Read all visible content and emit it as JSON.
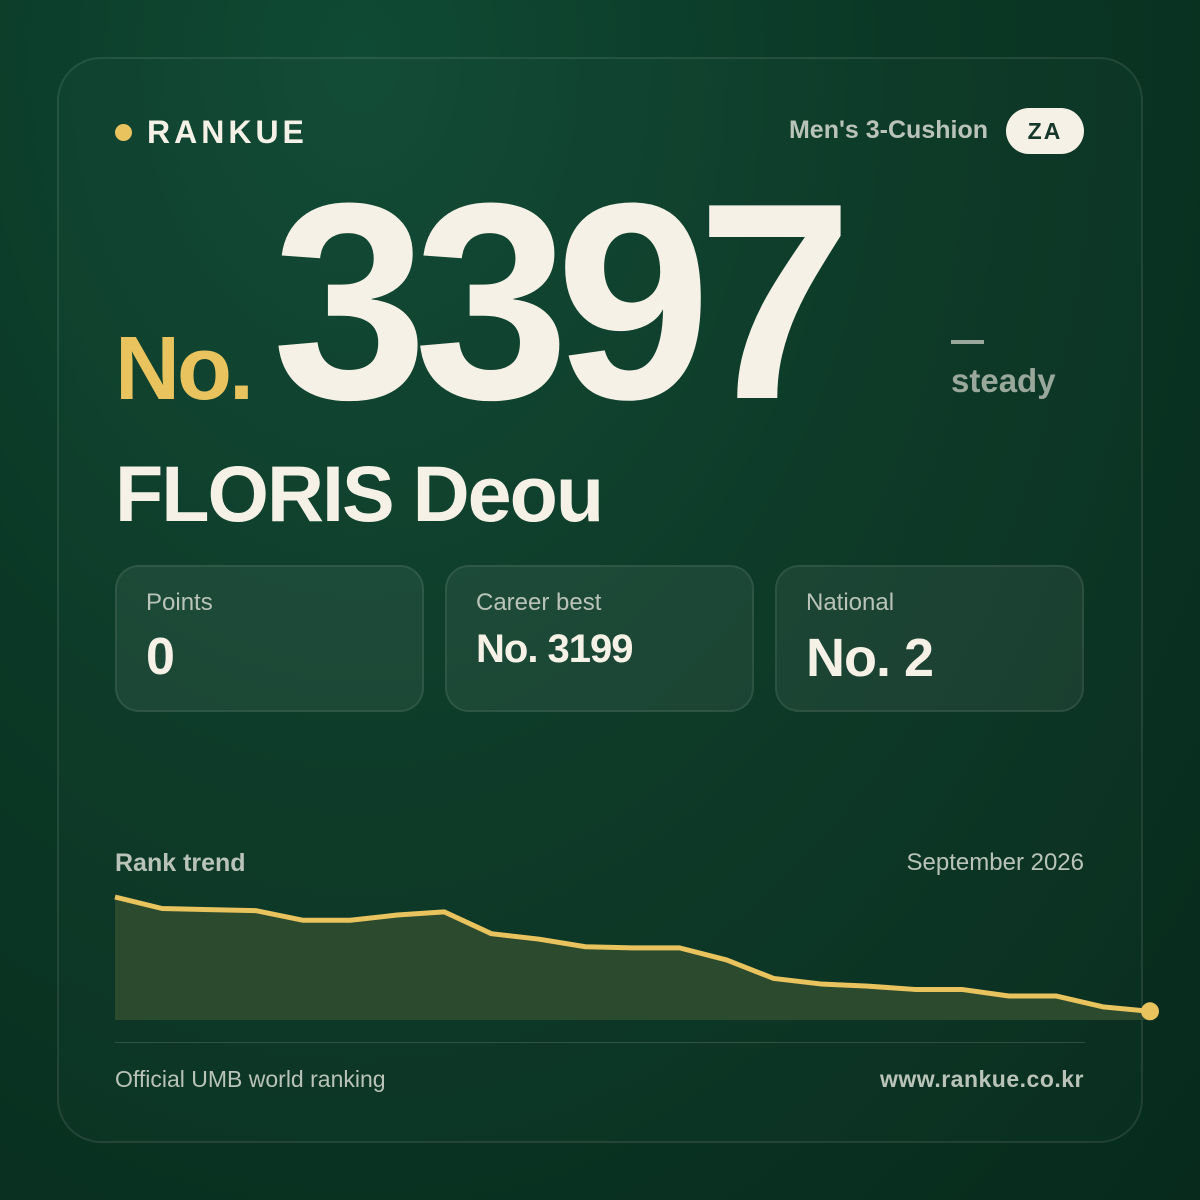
{
  "brand": {
    "name": "RANKUE",
    "dot_color": "#e8c35e"
  },
  "header": {
    "category": "Men's 3-Cushion",
    "country_code": "ZA"
  },
  "rank": {
    "prefix": "No.",
    "number": "3397",
    "trend_symbol": "—",
    "trend_label": "steady"
  },
  "player": {
    "name": "FLORIS Deou"
  },
  "stats": [
    {
      "label": "Points",
      "value": "0"
    },
    {
      "label": "Career best",
      "value": "No. 3199"
    },
    {
      "label": "National",
      "value": "No. 2"
    }
  ],
  "trend": {
    "title": "Rank trend",
    "date": "September 2026"
  },
  "chart_data": {
    "type": "area",
    "title": "Rank trend",
    "x": [
      0,
      1,
      2,
      3,
      4,
      5,
      6,
      7,
      8,
      9,
      10,
      11,
      12,
      13,
      14,
      15,
      16,
      17,
      18,
      19,
      20,
      21,
      22
    ],
    "values": [
      0.962,
      0.872,
      0.863,
      0.855,
      0.78,
      0.78,
      0.821,
      0.846,
      0.675,
      0.633,
      0.573,
      0.564,
      0.564,
      0.47,
      0.325,
      0.282,
      0.265,
      0.239,
      0.239,
      0.188,
      0.188,
      0.103,
      0.068
    ],
    "y_meaning": "relative position of trend line (higher = worse rank)",
    "line_color": "#e8c35e",
    "fill_color": "#2c4a2e"
  },
  "footer": {
    "left": "Official UMB world ranking",
    "right": "www.rankue.co.kr"
  }
}
